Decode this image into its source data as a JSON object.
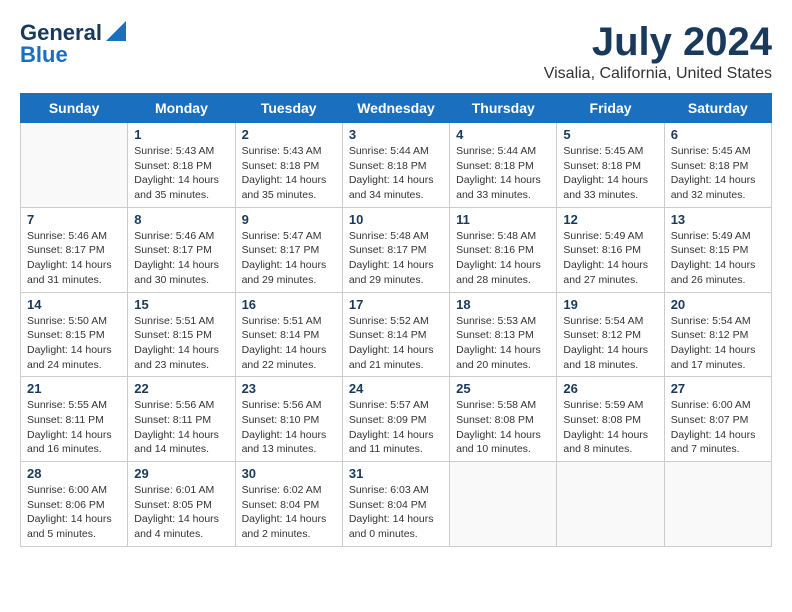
{
  "header": {
    "logo_line1": "General",
    "logo_line2": "Blue",
    "main_title": "July 2024",
    "subtitle": "Visalia, California, United States"
  },
  "weekdays": [
    "Sunday",
    "Monday",
    "Tuesday",
    "Wednesday",
    "Thursday",
    "Friday",
    "Saturday"
  ],
  "weeks": [
    [
      {
        "day": "",
        "info": ""
      },
      {
        "day": "1",
        "info": "Sunrise: 5:43 AM\nSunset: 8:18 PM\nDaylight: 14 hours\nand 35 minutes."
      },
      {
        "day": "2",
        "info": "Sunrise: 5:43 AM\nSunset: 8:18 PM\nDaylight: 14 hours\nand 35 minutes."
      },
      {
        "day": "3",
        "info": "Sunrise: 5:44 AM\nSunset: 8:18 PM\nDaylight: 14 hours\nand 34 minutes."
      },
      {
        "day": "4",
        "info": "Sunrise: 5:44 AM\nSunset: 8:18 PM\nDaylight: 14 hours\nand 33 minutes."
      },
      {
        "day": "5",
        "info": "Sunrise: 5:45 AM\nSunset: 8:18 PM\nDaylight: 14 hours\nand 33 minutes."
      },
      {
        "day": "6",
        "info": "Sunrise: 5:45 AM\nSunset: 8:18 PM\nDaylight: 14 hours\nand 32 minutes."
      }
    ],
    [
      {
        "day": "7",
        "info": "Sunrise: 5:46 AM\nSunset: 8:17 PM\nDaylight: 14 hours\nand 31 minutes."
      },
      {
        "day": "8",
        "info": "Sunrise: 5:46 AM\nSunset: 8:17 PM\nDaylight: 14 hours\nand 30 minutes."
      },
      {
        "day": "9",
        "info": "Sunrise: 5:47 AM\nSunset: 8:17 PM\nDaylight: 14 hours\nand 29 minutes."
      },
      {
        "day": "10",
        "info": "Sunrise: 5:48 AM\nSunset: 8:17 PM\nDaylight: 14 hours\nand 29 minutes."
      },
      {
        "day": "11",
        "info": "Sunrise: 5:48 AM\nSunset: 8:16 PM\nDaylight: 14 hours\nand 28 minutes."
      },
      {
        "day": "12",
        "info": "Sunrise: 5:49 AM\nSunset: 8:16 PM\nDaylight: 14 hours\nand 27 minutes."
      },
      {
        "day": "13",
        "info": "Sunrise: 5:49 AM\nSunset: 8:15 PM\nDaylight: 14 hours\nand 26 minutes."
      }
    ],
    [
      {
        "day": "14",
        "info": "Sunrise: 5:50 AM\nSunset: 8:15 PM\nDaylight: 14 hours\nand 24 minutes."
      },
      {
        "day": "15",
        "info": "Sunrise: 5:51 AM\nSunset: 8:15 PM\nDaylight: 14 hours\nand 23 minutes."
      },
      {
        "day": "16",
        "info": "Sunrise: 5:51 AM\nSunset: 8:14 PM\nDaylight: 14 hours\nand 22 minutes."
      },
      {
        "day": "17",
        "info": "Sunrise: 5:52 AM\nSunset: 8:14 PM\nDaylight: 14 hours\nand 21 minutes."
      },
      {
        "day": "18",
        "info": "Sunrise: 5:53 AM\nSunset: 8:13 PM\nDaylight: 14 hours\nand 20 minutes."
      },
      {
        "day": "19",
        "info": "Sunrise: 5:54 AM\nSunset: 8:12 PM\nDaylight: 14 hours\nand 18 minutes."
      },
      {
        "day": "20",
        "info": "Sunrise: 5:54 AM\nSunset: 8:12 PM\nDaylight: 14 hours\nand 17 minutes."
      }
    ],
    [
      {
        "day": "21",
        "info": "Sunrise: 5:55 AM\nSunset: 8:11 PM\nDaylight: 14 hours\nand 16 minutes."
      },
      {
        "day": "22",
        "info": "Sunrise: 5:56 AM\nSunset: 8:11 PM\nDaylight: 14 hours\nand 14 minutes."
      },
      {
        "day": "23",
        "info": "Sunrise: 5:56 AM\nSunset: 8:10 PM\nDaylight: 14 hours\nand 13 minutes."
      },
      {
        "day": "24",
        "info": "Sunrise: 5:57 AM\nSunset: 8:09 PM\nDaylight: 14 hours\nand 11 minutes."
      },
      {
        "day": "25",
        "info": "Sunrise: 5:58 AM\nSunset: 8:08 PM\nDaylight: 14 hours\nand 10 minutes."
      },
      {
        "day": "26",
        "info": "Sunrise: 5:59 AM\nSunset: 8:08 PM\nDaylight: 14 hours\nand 8 minutes."
      },
      {
        "day": "27",
        "info": "Sunrise: 6:00 AM\nSunset: 8:07 PM\nDaylight: 14 hours\nand 7 minutes."
      }
    ],
    [
      {
        "day": "28",
        "info": "Sunrise: 6:00 AM\nSunset: 8:06 PM\nDaylight: 14 hours\nand 5 minutes."
      },
      {
        "day": "29",
        "info": "Sunrise: 6:01 AM\nSunset: 8:05 PM\nDaylight: 14 hours\nand 4 minutes."
      },
      {
        "day": "30",
        "info": "Sunrise: 6:02 AM\nSunset: 8:04 PM\nDaylight: 14 hours\nand 2 minutes."
      },
      {
        "day": "31",
        "info": "Sunrise: 6:03 AM\nSunset: 8:04 PM\nDaylight: 14 hours\nand 0 minutes."
      },
      {
        "day": "",
        "info": ""
      },
      {
        "day": "",
        "info": ""
      },
      {
        "day": "",
        "info": ""
      }
    ]
  ]
}
